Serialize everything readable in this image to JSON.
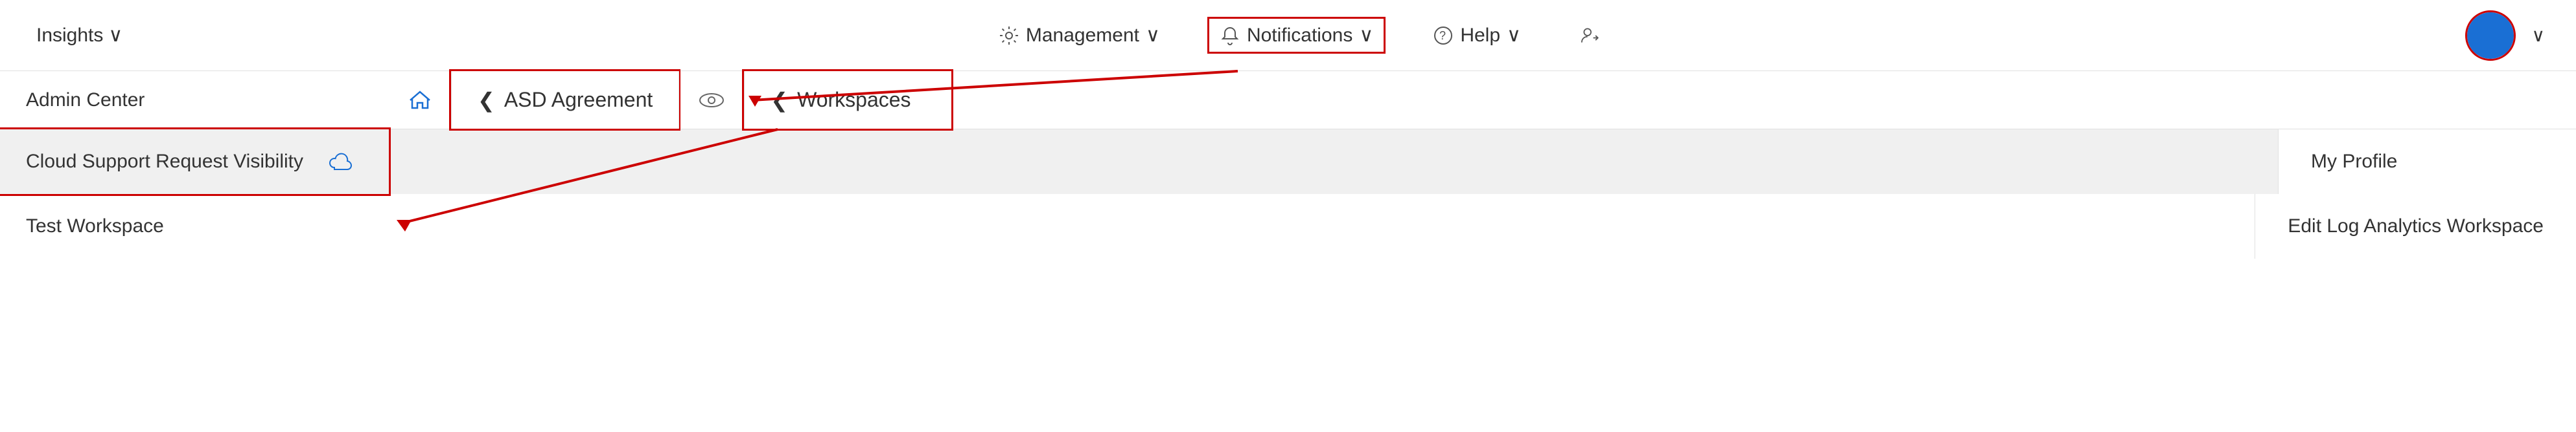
{
  "topbar": {
    "insights_label": "Insights",
    "chevron": "∨",
    "management_label": "Management",
    "notifications_label": "Notifications",
    "help_label": "Help"
  },
  "second_row": {
    "admin_center_label": "Admin Center",
    "asd_agreement_label": "ASD Agreement",
    "workspaces_label": "Workspaces"
  },
  "third_row": {
    "cloud_support_label": "Cloud Support Request Visibility",
    "my_profile_label": "My Profile"
  },
  "fourth_row": {
    "test_workspace_label": "Test Workspace",
    "edit_log_label": "Edit Log Analytics Workspace"
  },
  "icons": {
    "chevron_left": "❮",
    "chevron_down": "∨",
    "home": "⌂",
    "cloud": "☁",
    "gear": "⚙",
    "bell": "🔔",
    "help_circle": "?",
    "user_switch": "⇄",
    "arrow_left": "←",
    "eye": "👁"
  }
}
